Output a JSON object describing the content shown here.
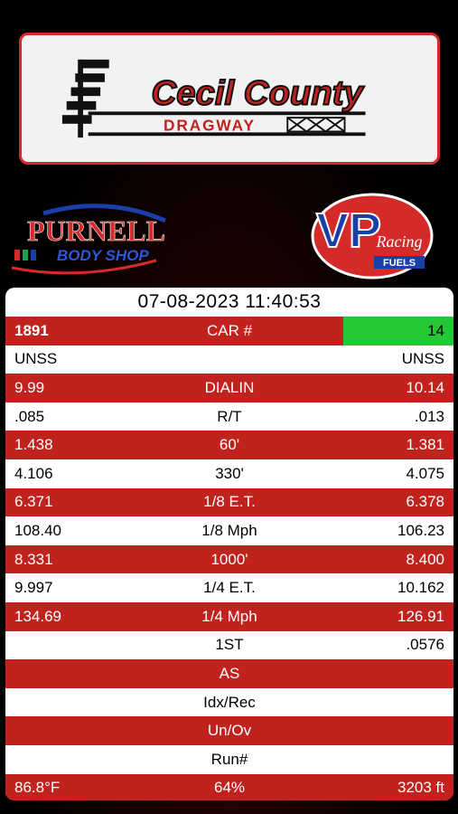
{
  "banner": {
    "line1": "Cecil County",
    "line2": "DRAGWAY"
  },
  "sponsors": {
    "left": {
      "line1": "PURNELL",
      "line2": "BODY SHOP"
    },
    "right": {
      "main": "VP",
      "sub1": "Racing",
      "sub2": "FUELS"
    }
  },
  "timestamp": "07-08-2023 11:40:53",
  "rows": [
    {
      "left": "1891",
      "label": "CAR #",
      "right": "14"
    },
    {
      "left": "UNSS",
      "label": "",
      "right": "UNSS"
    },
    {
      "left": "9.99",
      "label": "DIALIN",
      "right": "10.14"
    },
    {
      "left": ".085",
      "label": "R/T",
      "right": ".013"
    },
    {
      "left": "1.438",
      "label": "60'",
      "right": "1.381"
    },
    {
      "left": "4.106",
      "label": "330'",
      "right": "4.075"
    },
    {
      "left": "6.371",
      "label": "1/8 E.T.",
      "right": "6.378"
    },
    {
      "left": "108.40",
      "label": "1/8 Mph",
      "right": "106.23"
    },
    {
      "left": "8.331",
      "label": "1000'",
      "right": "8.400"
    },
    {
      "left": "9.997",
      "label": "1/4 E.T.",
      "right": "10.162"
    },
    {
      "left": "134.69",
      "label": "1/4 Mph",
      "right": "126.91"
    },
    {
      "left": "",
      "label": "1ST",
      "right": ".0576"
    },
    {
      "left": "",
      "label": "AS",
      "right": ""
    },
    {
      "left": "",
      "label": "Idx/Rec",
      "right": ""
    },
    {
      "left": "",
      "label": "Un/Ov",
      "right": ""
    },
    {
      "left": "",
      "label": "Run#",
      "right": ""
    },
    {
      "left": "86.8°F",
      "label": "64%",
      "right": "3203 ft"
    }
  ],
  "colors": {
    "red": "#c0231e",
    "green": "#22c934",
    "white": "#ffffff"
  }
}
